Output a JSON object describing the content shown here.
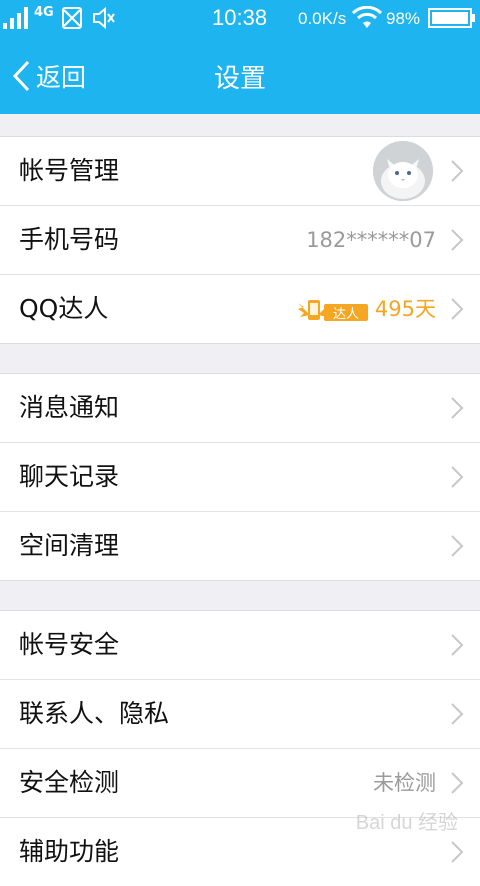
{
  "statusbar": {
    "network": "4G",
    "time": "10:38",
    "speed": "0.0K/s",
    "battery": "98%"
  },
  "header": {
    "back_label": "返回",
    "title": "设置"
  },
  "groups": [
    {
      "rows": [
        {
          "label": "帐号管理",
          "value": "",
          "kind": "avatar"
        },
        {
          "label": "手机号码",
          "value": "182******07",
          "kind": "text"
        },
        {
          "label": "QQ达人",
          "value": "495天",
          "badge": "达人",
          "kind": "badge"
        }
      ]
    },
    {
      "rows": [
        {
          "label": "消息通知"
        },
        {
          "label": "聊天记录"
        },
        {
          "label": "空间清理"
        }
      ]
    },
    {
      "rows": [
        {
          "label": "帐号安全"
        },
        {
          "label": "联系人、隐私"
        },
        {
          "label": "安全检测",
          "value": "未检测"
        },
        {
          "label": "辅助功能"
        }
      ]
    }
  ],
  "watermark": "Bai du 经验",
  "colors": {
    "accent": "#1eb4f0",
    "badge": "#f5a623",
    "background": "#efeff4"
  },
  "icons": [
    "signal-icon",
    "no-sim-icon",
    "mute-icon",
    "wifi-icon",
    "battery-icon",
    "back-chevron-icon",
    "chevron-right-icon",
    "qq-daren-badge-icon"
  ]
}
